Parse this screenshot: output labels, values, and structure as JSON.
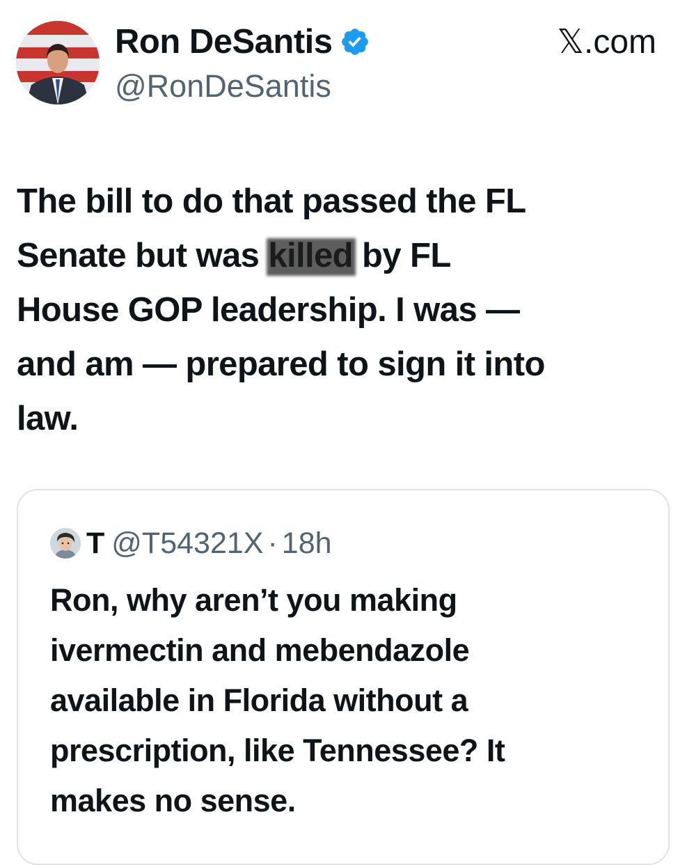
{
  "author": {
    "display_name": "Ron DeSantis",
    "handle": "@RonDeSantis",
    "verified_icon": "verified-badge-icon",
    "avatar_icon": "profile-photo"
  },
  "source_site": "𝕏.com",
  "tweet": {
    "lines": [
      {
        "before": "The bill to do that passed the FL",
        "redacted": "",
        "after": ""
      },
      {
        "before": "Senate but was ",
        "redacted": "killed",
        "after": " by FL"
      },
      {
        "before": "House GOP leadership.  I was —",
        "redacted": "",
        "after": ""
      },
      {
        "before": "and am — prepared to sign it into",
        "redacted": "",
        "after": ""
      },
      {
        "before": "law.",
        "redacted": "",
        "after": ""
      }
    ]
  },
  "quoted_tweet": {
    "display_name": "T",
    "handle": "@T54321X",
    "separator": "·",
    "time": "18h",
    "lines": [
      "Ron, why aren’t you making",
      "ivermectin and mebendazole",
      "available in Florida without a",
      "prescription, like Tennessee? It",
      "makes no sense."
    ]
  },
  "colors": {
    "text_primary": "#0f1419",
    "text_secondary": "#536471",
    "verified_blue": "#1d9bf0",
    "card_border": "#dfe3e6"
  }
}
